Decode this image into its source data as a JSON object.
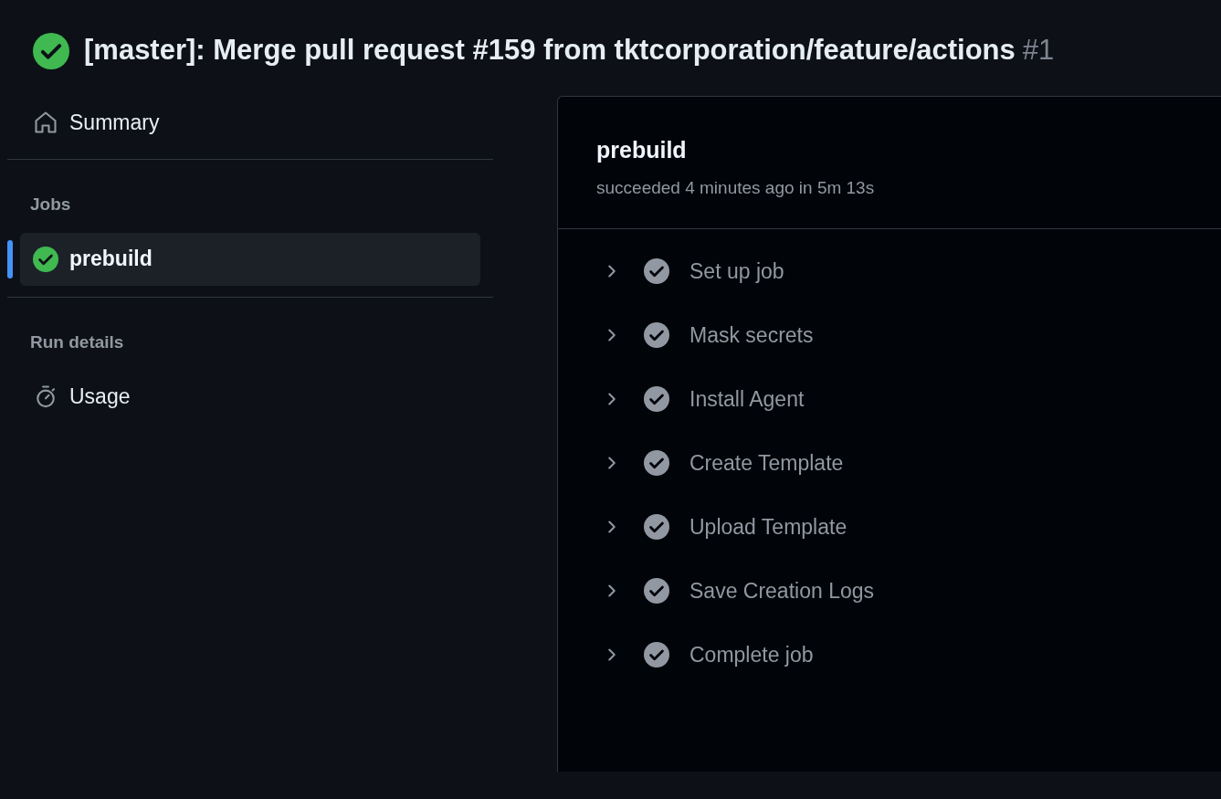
{
  "run": {
    "succeeded": true,
    "title": "[master]: Merge pull request #159 from tktcorporation/feature/actions",
    "number": "#1"
  },
  "sidebar": {
    "summary": "Summary",
    "jobs_heading": "Jobs",
    "jobs": [
      {
        "name": "prebuild",
        "succeeded": true,
        "selected": true
      }
    ],
    "run_details_heading": "Run details",
    "usage": "Usage"
  },
  "job": {
    "name": "prebuild",
    "subtitle": "succeeded 4 minutes ago in 5m 13s",
    "steps": [
      {
        "name": "Set up job",
        "succeeded": true,
        "expanded": false
      },
      {
        "name": "Mask secrets",
        "succeeded": true,
        "expanded": false
      },
      {
        "name": "Install Agent",
        "succeeded": true,
        "expanded": false
      },
      {
        "name": "Create Template",
        "succeeded": true,
        "expanded": false
      },
      {
        "name": "Upload Template",
        "succeeded": true,
        "expanded": false
      },
      {
        "name": "Save Creation Logs",
        "succeeded": true,
        "expanded": false
      },
      {
        "name": "Complete job",
        "succeeded": true,
        "expanded": false
      }
    ]
  }
}
